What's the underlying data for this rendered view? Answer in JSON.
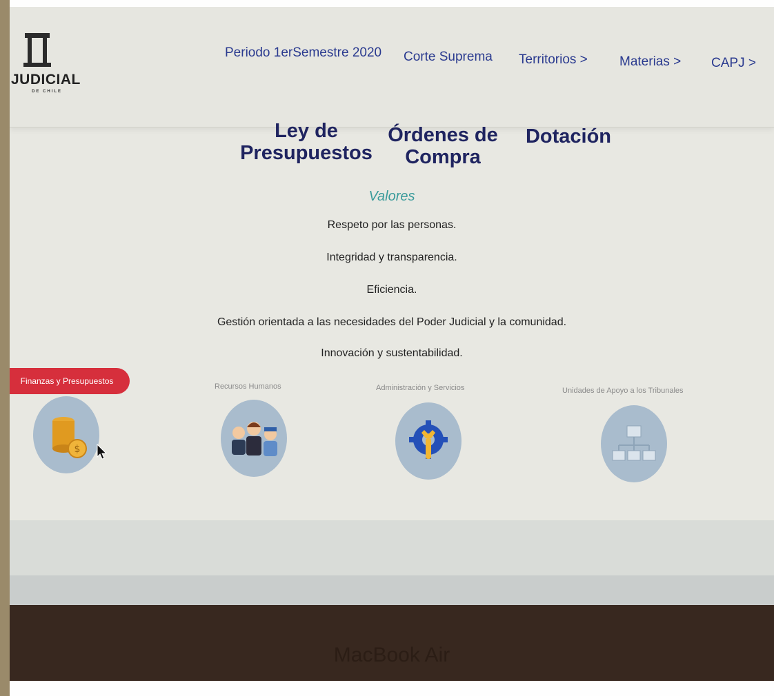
{
  "logo": {
    "text": "JUDICIAL",
    "subtext": "DE CHILE",
    "icon": "courthouse-icon"
  },
  "nav": [
    "Periodo 1erSemestre 2020",
    "Corte Suprema",
    "Territorios >",
    "Materias >",
    "CAPJ >"
  ],
  "headings": [
    "Ley de\nPresupuestos",
    "Órdenes de\nCompra",
    "Dotación"
  ],
  "valores": {
    "title": "Valores",
    "items": [
      "Respeto por las personas.",
      "Integridad y transparencia.",
      "Eficiencia.",
      "Gestión orientada a las necesidades del Poder Judicial y la comunidad.",
      "Innovación y sustentabilidad."
    ]
  },
  "areas": [
    {
      "label": "Finanzas y Presupuestos",
      "icon": "coins-icon",
      "active": true
    },
    {
      "label": "Recursos Humanos",
      "icon": "people-icon",
      "active": false
    },
    {
      "label": "Administración y Servicios",
      "icon": "wrench-gear-icon",
      "active": false
    },
    {
      "label": "Unidades de Apoyo a los Tribunales",
      "icon": "org-chart-icon",
      "active": false
    }
  ],
  "bezel": {
    "text": "MacBook Air"
  },
  "colors": {
    "nav": "#2a3a8f",
    "heading": "#1f2460",
    "valores_title": "#3a9b9b",
    "active_pill": "#d62f3c",
    "icon_circle": "#a9bccd"
  }
}
